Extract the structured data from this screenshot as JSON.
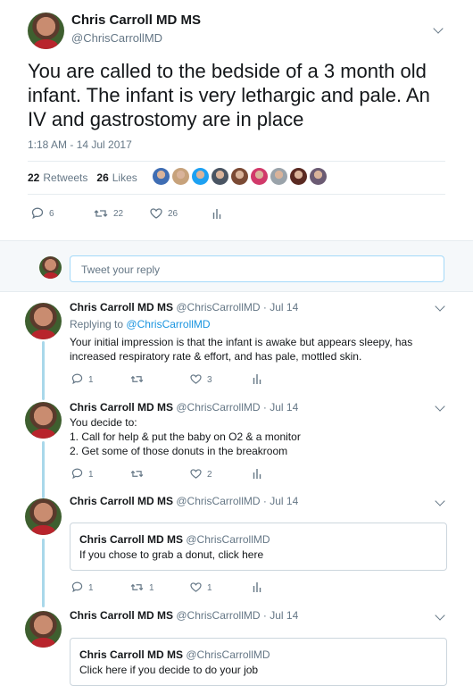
{
  "main_tweet": {
    "name": "Chris Carroll MD MS",
    "handle": "@ChrisCarrollMD",
    "text": "You are called to the bedside of a 3 month old infant. The infant is very lethargic and pale. An IV and gastrostomy are in place",
    "timestamp": "1:18 AM - 14 Jul 2017",
    "retweets_count": "22",
    "retweets_label": "Retweets",
    "likes_count": "26",
    "likes_label": "Likes",
    "liker_colors": [
      "#3f6db3",
      "#c7a27b",
      "#1da1f2",
      "#4a5563",
      "#7b4a35",
      "#d13a6a",
      "#9aa3aa",
      "#5a2a22",
      "#6b5b73"
    ],
    "actions": {
      "replies": "6",
      "retweets": "22",
      "likes": "26"
    }
  },
  "reply_box": {
    "placeholder": "Tweet your reply"
  },
  "replies": [
    {
      "name": "Chris Carroll MD MS",
      "handle": "@ChrisCarrollMD",
      "date": "Jul 14",
      "replying_to_prefix": "Replying to",
      "replying_to": "@ChrisCarrollMD",
      "text": "Your initial impression is that the infant is awake but appears sleepy, has increased respiratory rate & effort, and has pale, mottled skin.",
      "replies": "1",
      "retweets": "",
      "likes": "3"
    },
    {
      "name": "Chris Carroll MD MS",
      "handle": "@ChrisCarrollMD",
      "date": "Jul 14",
      "lines": [
        "You decide to:",
        "1. Call for help & put the baby on O2 & a monitor",
        "2. Get some of those donuts in the breakroom"
      ],
      "replies": "1",
      "retweets": "",
      "likes": "2"
    },
    {
      "name": "Chris Carroll MD MS",
      "handle": "@ChrisCarrollMD",
      "date": "Jul 14",
      "quote": {
        "name": "Chris Carroll MD MS",
        "handle": "@ChrisCarrollMD",
        "text": "If you chose to grab a donut, click here"
      },
      "replies": "1",
      "retweets": "1",
      "likes": "1"
    },
    {
      "name": "Chris Carroll MD MS",
      "handle": "@ChrisCarrollMD",
      "date": "Jul 14",
      "quote": {
        "name": "Chris Carroll MD MS",
        "handle": "@ChrisCarrollMD",
        "text": "Click here if you decide to do your job"
      }
    }
  ],
  "icons": {
    "reply": "reply-icon",
    "retweet": "retweet-icon",
    "like": "heart-icon",
    "analytics": "analytics-icon",
    "more": "chevron-down-icon"
  }
}
